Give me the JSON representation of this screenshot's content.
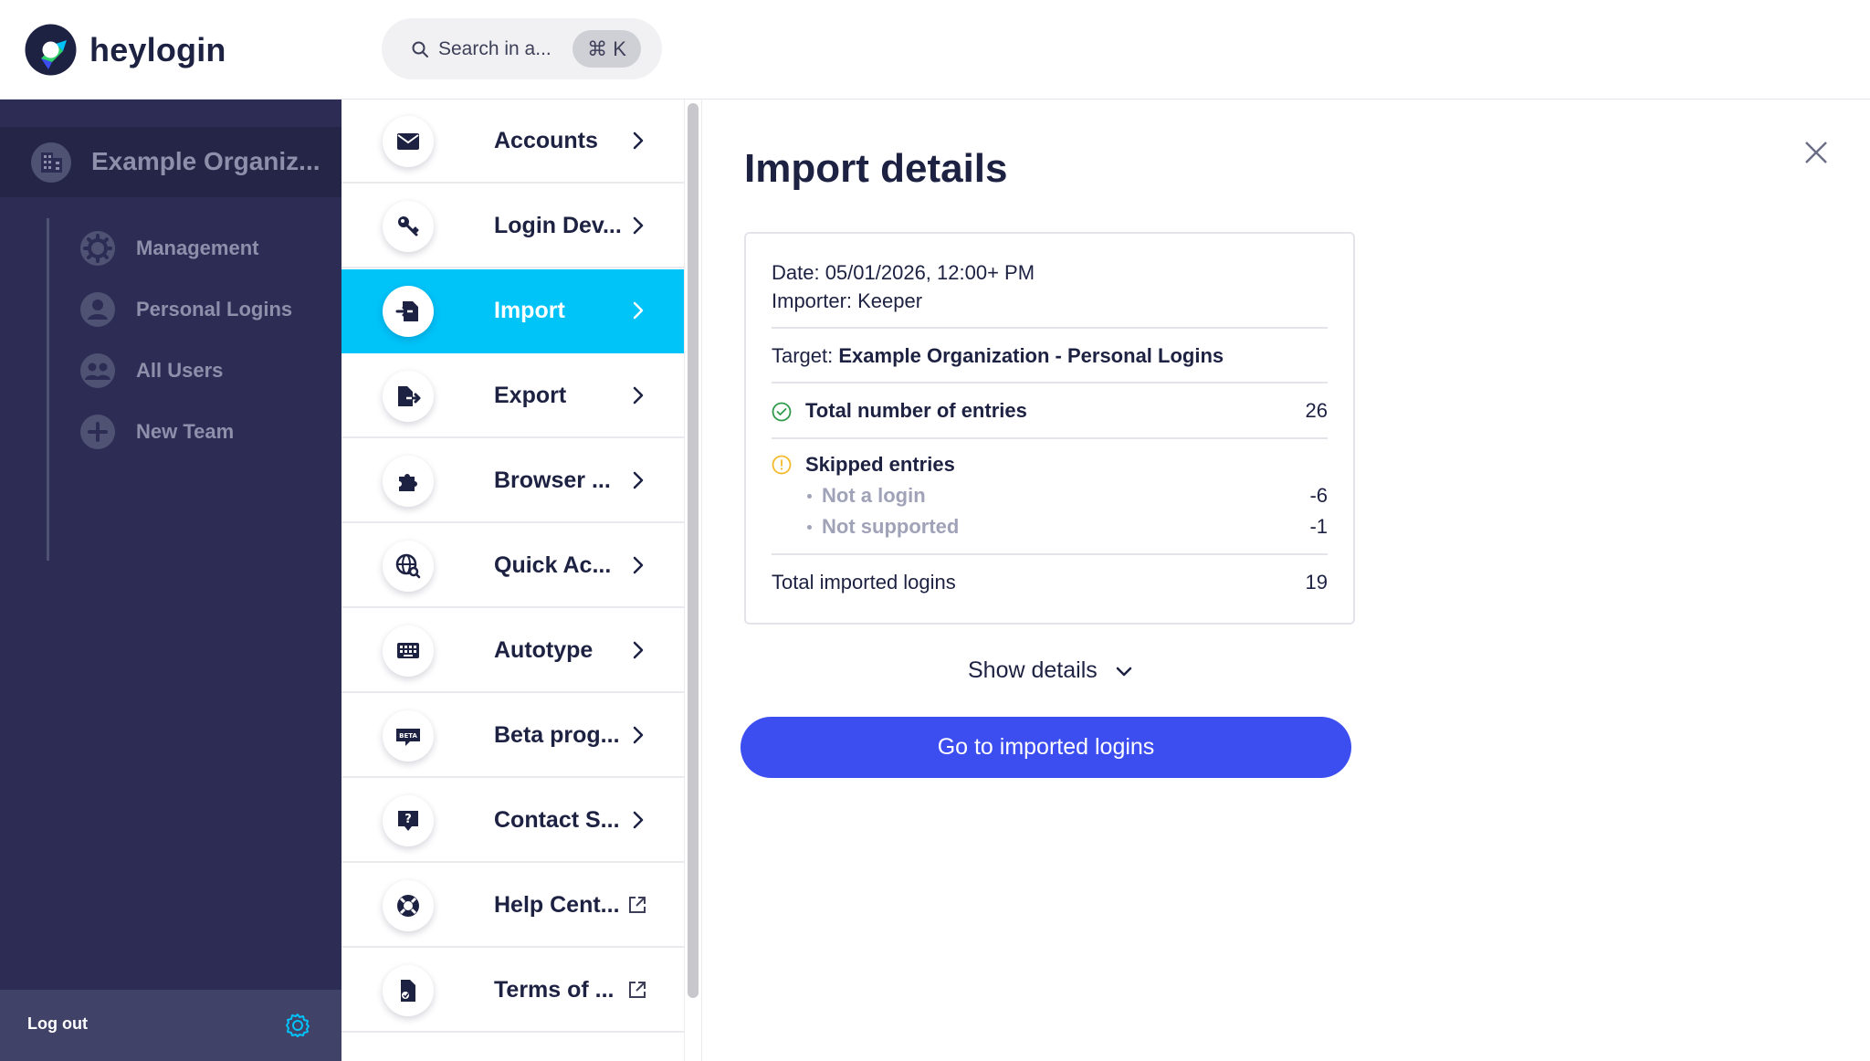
{
  "app": {
    "logo_text": "heylogin",
    "brand_color": "#3d4ef0",
    "accent_color": "#00c3f8",
    "sidebar_color": "#2c2c54"
  },
  "search": {
    "placeholder": "Search in a...",
    "shortcut": "⌘ K",
    "icon": "search-icon"
  },
  "sidebar": {
    "org_name": "Example Organiz...",
    "org_icon": "building-icon",
    "items": [
      {
        "label": "Management",
        "icon": "gear-icon"
      },
      {
        "label": "Personal Logins",
        "icon": "user-icon"
      },
      {
        "label": "All Users",
        "icon": "users-icon"
      },
      {
        "label": "New Team",
        "icon": "plus-icon"
      }
    ],
    "logout_label": "Log out",
    "settings_icon": "settings-icon"
  },
  "menu": {
    "items": [
      {
        "label": "Accounts",
        "icon": "envelope-icon",
        "trailing": "chevron-right-icon",
        "active": false
      },
      {
        "label": "Login Dev...",
        "icon": "key-icon",
        "trailing": "chevron-right-icon",
        "active": false
      },
      {
        "label": "Import",
        "icon": "import-icon",
        "trailing": "chevron-right-icon",
        "active": true
      },
      {
        "label": "Export",
        "icon": "export-icon",
        "trailing": "chevron-right-icon",
        "active": false
      },
      {
        "label": "Browser ...",
        "icon": "puzzle-icon",
        "trailing": "chevron-right-icon",
        "active": false
      },
      {
        "label": "Quick Ac...",
        "icon": "globe-search-icon",
        "trailing": "chevron-right-icon",
        "active": false
      },
      {
        "label": "Autotype",
        "icon": "keyboard-icon",
        "trailing": "chevron-right-icon",
        "active": false
      },
      {
        "label": "Beta prog...",
        "icon": "beta-icon",
        "trailing": "chevron-right-icon",
        "active": false
      },
      {
        "label": "Contact S...",
        "icon": "help-chat-icon",
        "trailing": "chevron-right-icon",
        "active": false
      },
      {
        "label": "Help Cent...",
        "icon": "lifebuoy-icon",
        "trailing": "external-link-icon",
        "active": false
      },
      {
        "label": "Terms of ...",
        "icon": "document-icon",
        "trailing": "external-link-icon",
        "active": false
      }
    ]
  },
  "details": {
    "title": "Import details",
    "date": "Date: 05/01/2026, 12:00+ PM",
    "importer": "Importer: Keeper",
    "target_prefix": "Target: ",
    "target_value": "Example Organization - Personal Logins",
    "total_entries_label": "Total number of entries",
    "total_entries_value": "26",
    "skipped_label": "Skipped entries",
    "skipped": [
      {
        "label": "Not a login",
        "value": "-6"
      },
      {
        "label": "Not supported",
        "value": "-1"
      }
    ],
    "total_imported_label": "Total imported logins",
    "total_imported_value": "19",
    "show_details_label": "Show details",
    "cta_label": "Go to imported logins",
    "success_color": "#2e9b4a",
    "warning_color": "#f5b92b"
  }
}
